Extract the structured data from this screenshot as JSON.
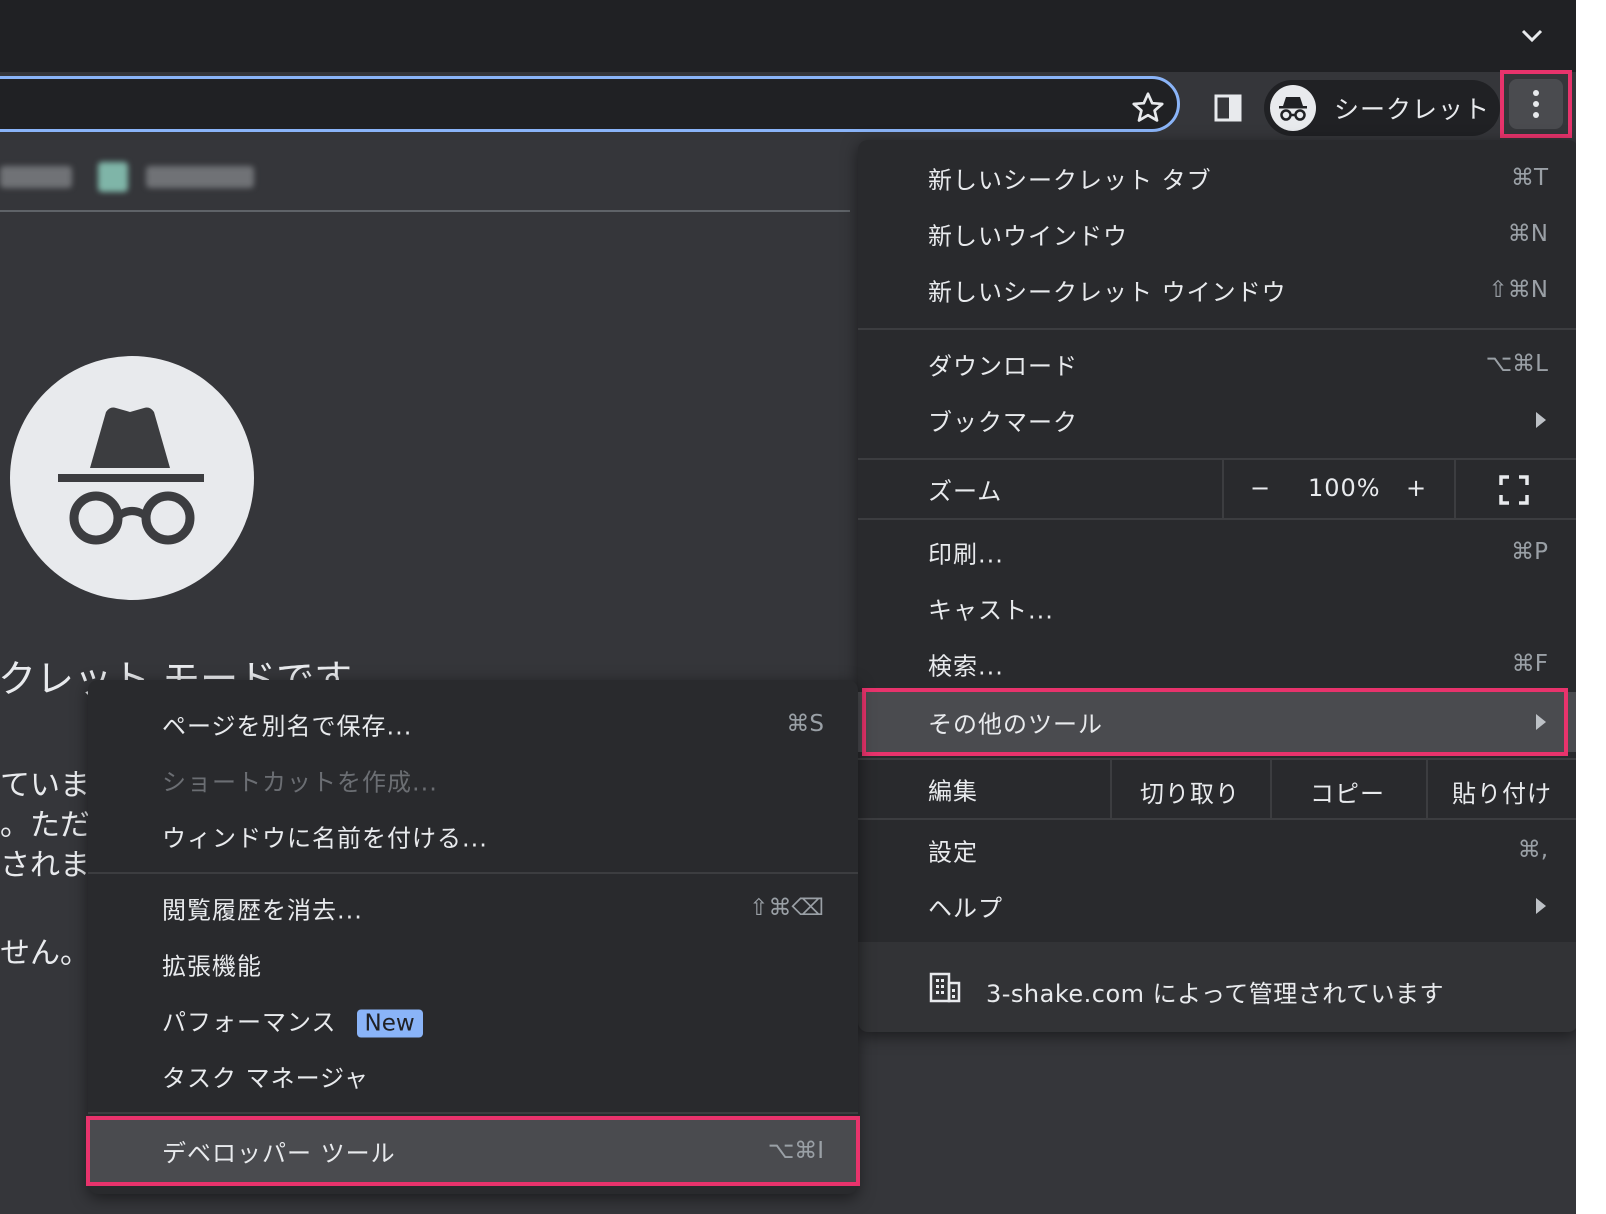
{
  "toolbar": {
    "incognito_label": "シークレット"
  },
  "ntp": {
    "heading_partial": "クレット モードです",
    "lines": [
      "ています",
      "。ただ",
      "されます",
      "せん。"
    ]
  },
  "menu": {
    "items_top": [
      {
        "label": "新しいシークレット タブ",
        "shortcut": "⌘T"
      },
      {
        "label": "新しいウインドウ",
        "shortcut": "⌘N"
      },
      {
        "label": "新しいシークレット ウインドウ",
        "shortcut": "⇧⌘N"
      }
    ],
    "items_mid": [
      {
        "label": "ダウンロード",
        "shortcut": "⌥⌘L"
      },
      {
        "label": "ブックマーク",
        "shortcut": ""
      }
    ],
    "zoom": {
      "label": "ズーム",
      "minus": "−",
      "value": "100%",
      "plus": "+"
    },
    "items_tools": [
      {
        "label": "印刷...",
        "shortcut": "⌘P"
      },
      {
        "label": "キャスト...",
        "shortcut": ""
      },
      {
        "label": "検索...",
        "shortcut": "⌘F"
      },
      {
        "label": "その他のツール",
        "shortcut": ""
      }
    ],
    "edit": {
      "label": "編集",
      "cut": "切り取り",
      "copy": "コピー",
      "paste": "貼り付け"
    },
    "items_bottom": [
      {
        "label": "設定",
        "shortcut": "⌘,"
      },
      {
        "label": "ヘルプ",
        "shortcut": ""
      }
    ],
    "managed_text": "3-shake.com によって管理されています"
  },
  "submenu": {
    "items": [
      {
        "label": "ページを別名で保存...",
        "shortcut": "⌘S"
      },
      {
        "label": "ショートカットを作成...",
        "shortcut": ""
      },
      {
        "label": "ウィンドウに名前を付ける...",
        "shortcut": ""
      },
      {
        "label": "閲覧履歴を消去...",
        "shortcut": "⇧⌘⌫"
      },
      {
        "label": "拡張機能",
        "shortcut": ""
      },
      {
        "label": "パフォーマンス",
        "shortcut": "",
        "badge": "New"
      },
      {
        "label": "タスク マネージャ",
        "shortcut": ""
      },
      {
        "label": "デベロッパー ツール",
        "shortcut": "⌥⌘I"
      }
    ]
  },
  "colors": {
    "highlight": "#e8336c",
    "accent": "#8ab4f8",
    "background": "#35363a",
    "menu_bg": "#292a2d"
  },
  "icons": [
    "chevron-down-icon",
    "star-icon",
    "side-panel-icon",
    "incognito-icon",
    "more-vert-icon",
    "fullscreen-icon",
    "building-icon",
    "submenu-arrow-icon"
  ]
}
